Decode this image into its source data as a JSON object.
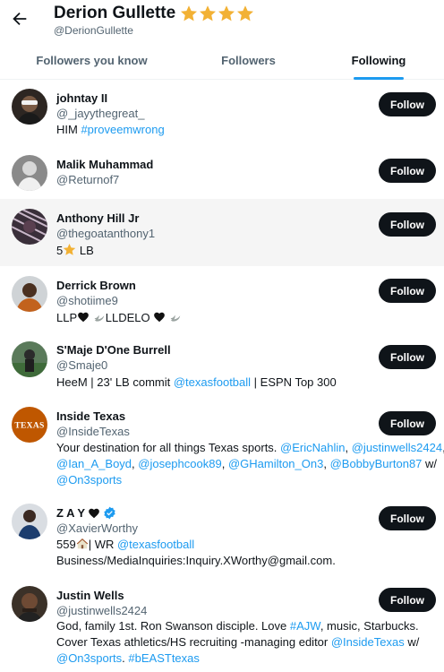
{
  "header": {
    "title": "Derion Gullette",
    "handle": "@DerionGullette",
    "star_color": "#f2b134"
  },
  "tabs": [
    {
      "label": "Followers you know",
      "active": false
    },
    {
      "label": "Followers",
      "active": false
    },
    {
      "label": "Following",
      "active": true
    }
  ],
  "colors": {
    "link": "#1d9bf0",
    "text": "#0f1419",
    "secondary": "#536471",
    "button": "#0f1419",
    "verified": "#1d9bf0"
  },
  "users": [
    {
      "name": "johntay II",
      "handle": "@_jayythegreat_",
      "button": "Follow",
      "bio": {
        "t1": "HIM ",
        "link1": "#proveemwrong"
      }
    },
    {
      "name": "Malik Muhammad",
      "handle": "@Returnof7",
      "button": "Follow"
    },
    {
      "name": "Anthony Hill Jr",
      "handle": "@thegoatanthony1",
      "button": "Follow",
      "bio": {
        "t1": "5",
        "icon1": "star-emoji",
        "t2": " LB"
      }
    },
    {
      "name": "Derrick Brown",
      "handle": "@shotiime9",
      "button": "Follow",
      "bio": {
        "t1": "LLP",
        "icon1": "black-heart-emoji",
        "icon2": "dove-emoji",
        "t2": "LLDELO ",
        "icon3": "black-heart-emoji",
        "icon4": "dove-emoji"
      }
    },
    {
      "name": "S'Maje D'One Burrell",
      "handle": "@Smaje0",
      "button": "Follow",
      "bio": {
        "t1": "HeeM | 23' LB commit ",
        "link1": "@texasfootball",
        "t2": " | ESPN Top 300"
      }
    },
    {
      "name": "Inside Texas",
      "handle": "@InsideTexas",
      "button": "Follow",
      "avatar_text": "TEXAS",
      "bio": {
        "t1": "Your destination for all things Texas sports. ",
        "link1": "@EricNahlin",
        "sep1": ", ",
        "link2": "@justinwells2424",
        "sep2": ",",
        "link3": "@Ian_A_Boyd",
        "sep3": ", ",
        "link4": "@josephcook89",
        "sep4": ", ",
        "link5": "@GHamilton_On3",
        "sep5": ", ",
        "link6": "@BobbyBurton87",
        "t2": " w/",
        "link7": "@On3sports"
      }
    },
    {
      "name": "Z A Y",
      "name_icon": "black-heart-emoji",
      "verified": true,
      "handle": "@XavierWorthy",
      "button": "Follow",
      "bio": {
        "t1": "559",
        "icon1": "house-emoji",
        "t2": "| WR ",
        "link1": "@texasfootball",
        "line2": "Business/MediaInquiries:Inquiry.XWorthy@gmail.com."
      }
    },
    {
      "name": "Justin Wells",
      "handle": "@justinwells2424",
      "button": "Follow",
      "bio": {
        "t1": "God, family 1st. Ron Swanson disciple. Love ",
        "link1": "#AJW",
        "t2": ", music, Starbucks.",
        "t3": "Cover Texas athletics/HS recruiting -managing editor ",
        "link2": "@InsideTexas",
        "t4": " w/",
        "link3": "@On3sports",
        "t5": ". ",
        "link4": "#bEASTtexas"
      }
    }
  ]
}
